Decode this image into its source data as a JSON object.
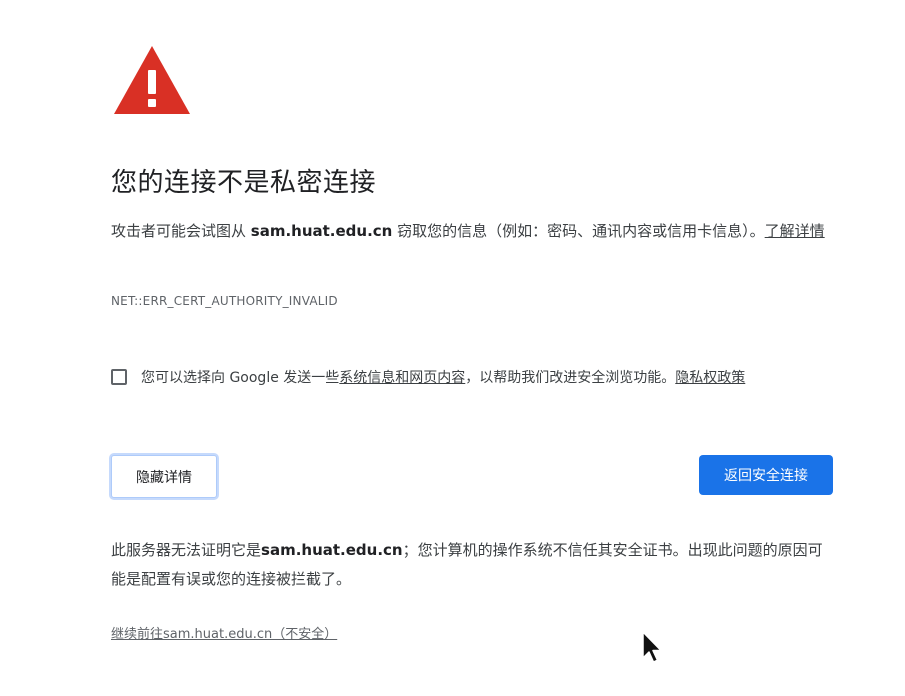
{
  "icon": {
    "name": "warning-triangle-icon",
    "color": "#d93025"
  },
  "title": "您的连接不是私密连接",
  "description": {
    "prefix": "攻击者可能会试图从 ",
    "host": "sam.huat.edu.cn",
    "suffix": " 窃取您的信息（例如：密码、通讯内容或信用卡信息）。",
    "learn_more": "了解详情"
  },
  "error_code": "NET::ERR_CERT_AUTHORITY_INVALID",
  "optin": {
    "checked": false,
    "prefix": "您可以选择向 Google 发送一些",
    "link": "系统信息和网页内容",
    "suffix": "，以帮助我们改进安全浏览功能。",
    "privacy_link": "隐私权政策"
  },
  "buttons": {
    "details": "隐藏详情",
    "back": "返回安全连接"
  },
  "details": {
    "prefix": "此服务器无法证明它是",
    "host": "sam.huat.edu.cn",
    "suffix": "；您计算机的操作系统不信任其安全证书。出现此问题的原因可能是配置有误或您的连接被拦截了。"
  },
  "proceed_link": "继续前往sam.huat.edu.cn（不安全）",
  "colors": {
    "accent": "#1a73e8",
    "danger": "#d93025"
  }
}
